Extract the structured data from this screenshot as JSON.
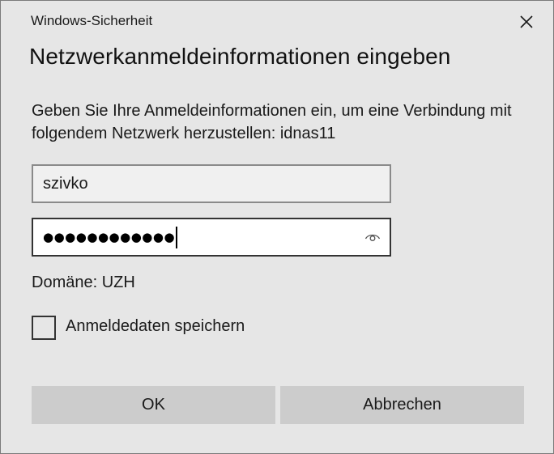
{
  "window": {
    "title": "Windows-Sicherheit",
    "close_icon": "close-icon"
  },
  "dialog": {
    "heading": "Netzwerkanmeldeinformationen eingeben",
    "description": "Geben Sie Ihre Anmeldeinformationen ein, um eine Verbindung mit folgendem Netzwerk herzustellen: idnas11"
  },
  "username_field": {
    "value": "szivko"
  },
  "password_field": {
    "masked_value": "●●●●●●●●●●●●",
    "reveal_icon": "eye-icon"
  },
  "domain": {
    "label": "Domäne: UZH"
  },
  "remember": {
    "label": "Anmeldedaten speichern",
    "checked": false
  },
  "buttons": {
    "ok_label": "OK",
    "cancel_label": "Abbrechen"
  },
  "colors": {
    "background": "#e6e6e6",
    "button_bg": "#cccccc",
    "field_border_focused": "#333333"
  }
}
